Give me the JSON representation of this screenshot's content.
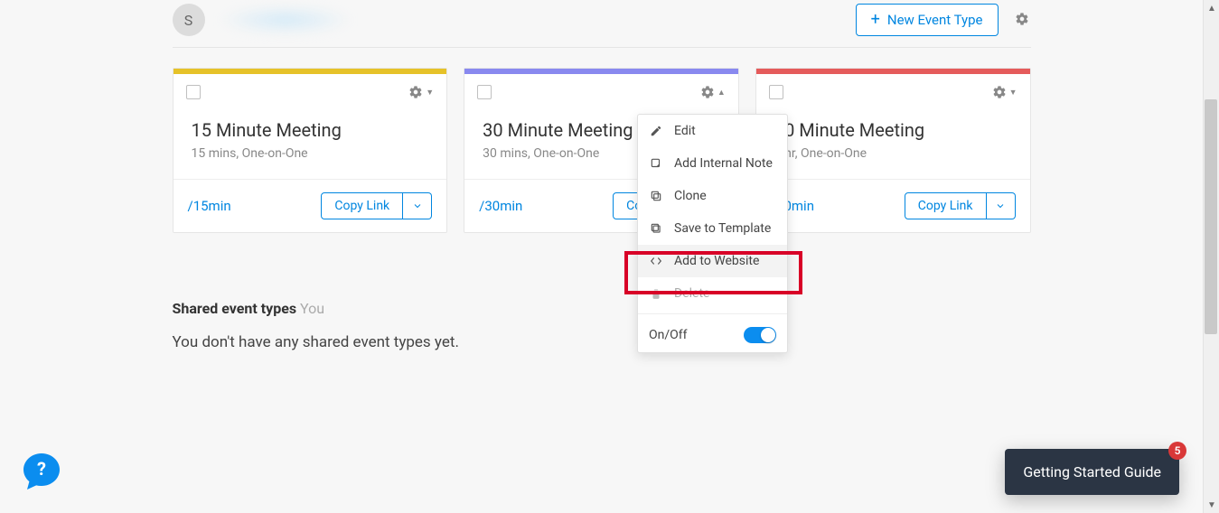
{
  "header": {
    "avatar_initial": "S",
    "new_event_label": "New Event Type"
  },
  "cards": [
    {
      "title": "15 Minute Meeting",
      "sub": "15 mins, One-on-One",
      "link": "/15min",
      "copy": "Copy Link"
    },
    {
      "title": "30 Minute Meeting",
      "sub": "30 mins, One-on-One",
      "link": "/30min",
      "copy": "Copy Link"
    },
    {
      "title": "60 Minute Meeting",
      "sub": "1 hr, One-on-One",
      "link": "/60min",
      "copy": "Copy Link"
    }
  ],
  "dropdown": {
    "edit": "Edit",
    "add_note": "Add Internal Note",
    "clone": "Clone",
    "save_template": "Save to Template",
    "add_website": "Add to Website",
    "delete": "Delete",
    "onoff": "On/Off"
  },
  "shared": {
    "heading_bold": "Shared event types",
    "heading_you": "You",
    "empty": "You don't have any shared event types yet."
  },
  "guide": {
    "label": "Getting Started Guide",
    "badge": "5"
  }
}
